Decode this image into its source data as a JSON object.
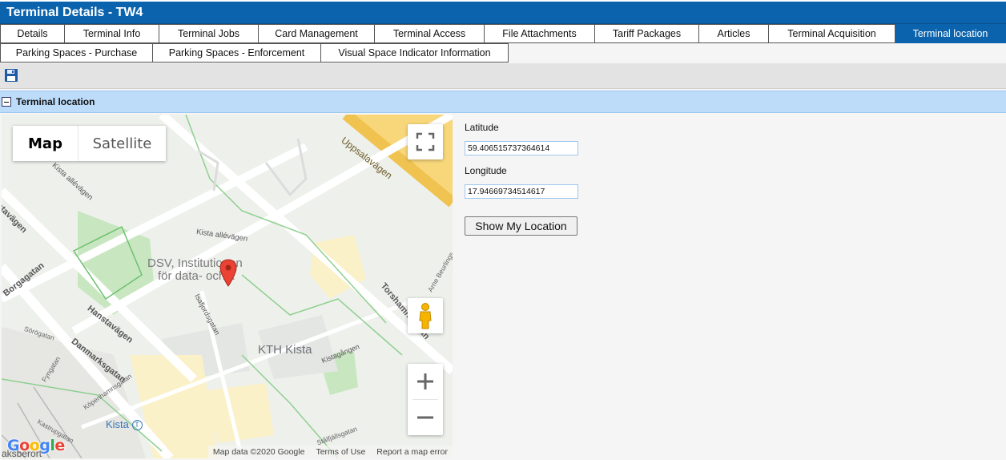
{
  "window": {
    "title": "Terminal Details - TW4"
  },
  "tabs_row1": [
    {
      "label": "Details"
    },
    {
      "label": "Terminal Info"
    },
    {
      "label": "Terminal Jobs"
    },
    {
      "label": "Card Management"
    },
    {
      "label": "Terminal Access"
    },
    {
      "label": "File Attachments"
    },
    {
      "label": "Tariff Packages"
    },
    {
      "label": "Articles"
    },
    {
      "label": "Terminal Acquisition"
    },
    {
      "label": "Terminal location"
    }
  ],
  "tabs_row2": [
    {
      "label": "Parking Spaces - Purchase"
    },
    {
      "label": "Parking Spaces - Enforcement"
    },
    {
      "label": "Visual Space Indicator Information"
    }
  ],
  "active_tab": "Terminal location",
  "toolbar": {
    "save_icon": "floppy-disk-icon"
  },
  "section": {
    "title": "Terminal location",
    "collapse_icon": "minus-box-icon"
  },
  "map": {
    "type_controls": {
      "map_label": "Map",
      "satellite_label": "Satellite",
      "selected": "Map"
    },
    "footer": {
      "map_data": "Map data ©2020 Google",
      "terms": "Terms of Use",
      "report": "Report a map error"
    },
    "logo": "Google",
    "street_labels": {
      "uppsalavagen": "Uppsalavägen",
      "kista_allevag": "Kista allévägen",
      "kista_allevag_top": "Kista allévägen",
      "hanstavagen": "Hanstavägen",
      "danmarksgatan": "Danmarksgatan",
      "torshamnsgatan": "Torshamnsgatan",
      "isafjordsgatan": "Isafjordsgatan",
      "kistagangen": "Kistagången",
      "borgagatan": "Borgagatan",
      "stavagen": "stavägen",
      "sorogatan": "Sörögatan",
      "fyngatan": "Fyngatan",
      "kastrupgatan": "Kastrupgatan",
      "kopenhamnsgatan": "Köpenhamnsgatan",
      "stalfjallsgatan": "Stålfjällsgatan",
      "arne_beurlings": "Arne Beurlings"
    },
    "place_labels": {
      "dsv_line1": "DSV, Institutionen",
      "dsv_line2": "för data- och...",
      "kth_kista": "KTH Kista",
      "kista_station": "Kista",
      "partial_bottom": "aksberort"
    }
  },
  "location": {
    "latitude_label": "Latitude",
    "latitude_value": "59.406515737364614",
    "longitude_label": "Longitude",
    "longitude_value": "17.94669734514617",
    "show_button": "Show My Location"
  },
  "colors": {
    "header_blue": "#0b63ad",
    "section_bg": "#bcdcf9",
    "road_yellow": "#f8d77a",
    "park_green": "#c8e7c1",
    "marker_red": "#ea4335"
  }
}
